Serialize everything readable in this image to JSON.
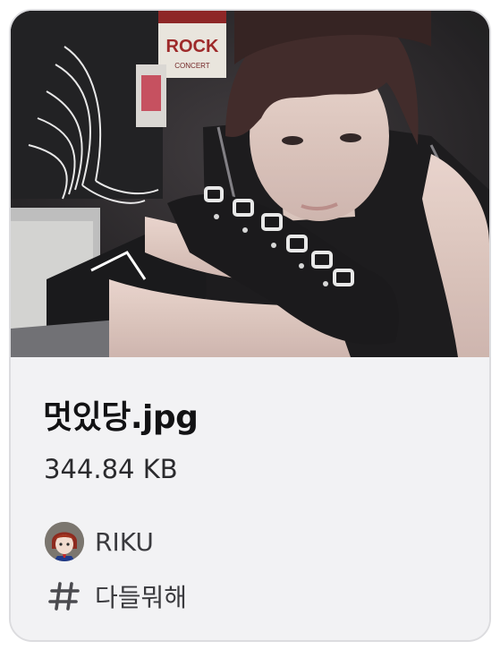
{
  "attachment": {
    "thumbnail_alt": "person with dark hair resting arms on knee, wearing black studded arm warmers",
    "poster_text": "ROCK",
    "poster_subtext": "CONCERT",
    "file_name": "멋있당.jpg",
    "file_size": "344.84 KB",
    "author_name": "RIKU",
    "channel_name": "다들뭐해"
  },
  "colors": {
    "card_background": "#f2f2f4",
    "card_border": "#dcdcdf",
    "title_text": "#121214",
    "secondary_text": "#3a3a3e"
  },
  "icons": {
    "avatar": "avatar",
    "channel": "hash-icon"
  }
}
